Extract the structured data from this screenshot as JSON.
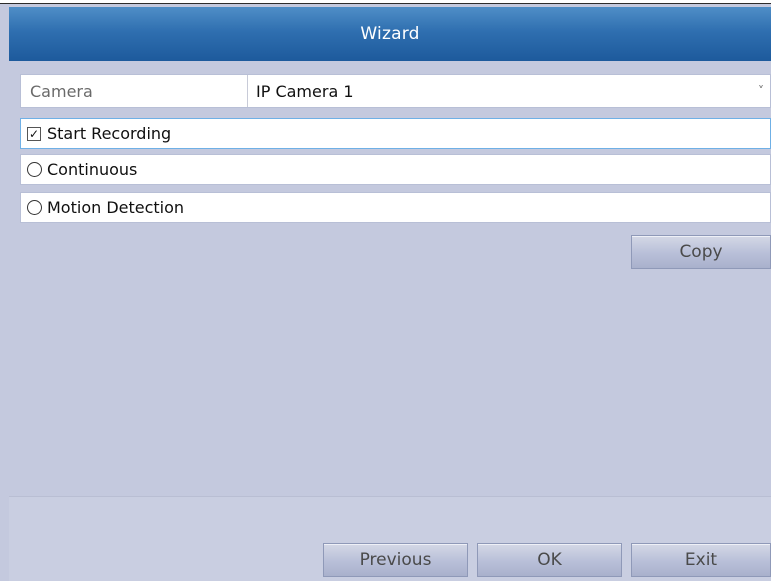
{
  "window": {
    "title": "Wizard"
  },
  "camera": {
    "label": "Camera",
    "selected": "IP Camera 1",
    "arrow": "˅"
  },
  "options": {
    "start_recording": {
      "label": "Start Recording",
      "checked": true,
      "check_glyph": "✓"
    },
    "continuous": {
      "label": "Continuous",
      "selected": false
    },
    "motion_detection": {
      "label": "Motion Detection",
      "selected": false
    }
  },
  "buttons": {
    "copy": "Copy",
    "previous": "Previous",
    "ok": "OK",
    "exit": "Exit"
  },
  "colors": {
    "title_bar": "#2f6fb0",
    "background": "#c4c9de",
    "button": "#b8bfd8",
    "highlight_border": "#6fb0e6"
  }
}
